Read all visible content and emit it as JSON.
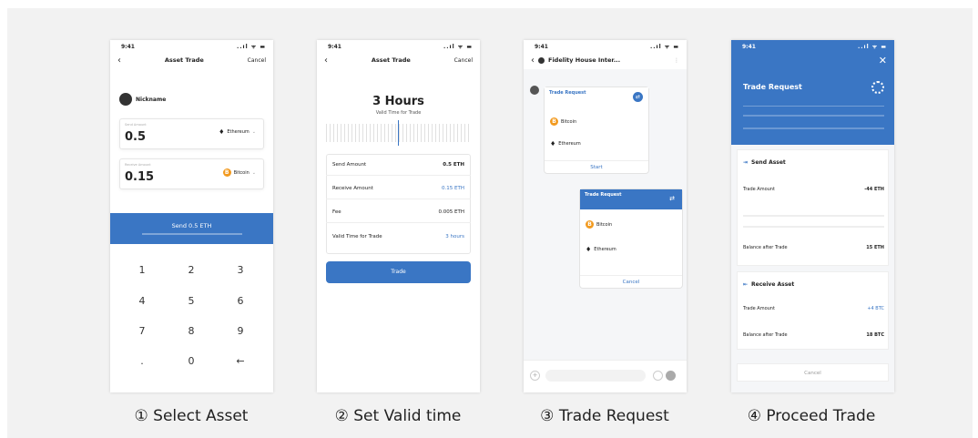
{
  "captions": [
    "① Select Asset",
    "② Set Valid time",
    "③ Trade Request",
    "④ Proceed Trade"
  ],
  "status": {
    "time": "9:41",
    "icons": "..ıl ᯤ ▬"
  },
  "p1": {
    "title": "Asset Trade",
    "cancel": "Cancel",
    "nickname": "Nickname",
    "send_label": "Send Amount",
    "send_value": "0.5",
    "send_coin": "Ethereum",
    "recv_label": "Receive Amount",
    "recv_value": "0.15",
    "recv_coin": "Bitcoin",
    "button": "Send 0.5 ETH",
    "keys": [
      "1",
      "2",
      "3",
      "4",
      "5",
      "6",
      "7",
      "8",
      "9",
      ".",
      "0",
      "←"
    ]
  },
  "p2": {
    "title": "Asset Trade",
    "cancel": "Cancel",
    "hours": "3 Hours",
    "valid_label": "Valid Time for Trade",
    "rows": [
      {
        "label": "Send Amount",
        "value": "0.5 ETH"
      },
      {
        "label": "Receive Amount",
        "value": "0.15 ETH"
      },
      {
        "label": "Fee",
        "value": "0.005 ETH"
      },
      {
        "label": "Valid Time for Trade",
        "value": "3 hours"
      }
    ],
    "button": "Trade"
  },
  "p3": {
    "chat_title": "Fidelity House Inter...",
    "req1_title": "Trade Request",
    "req1_coin1": "Bitcoin",
    "req1_coin2": "Ethereum",
    "req1_action": "Start",
    "req2_title": "Trade Request",
    "req2_coin1": "Bitcoin",
    "req2_coin2": "Ethereum",
    "req2_action": "Cancel"
  },
  "p4": {
    "title": "Trade Request",
    "send_section": "Send Asset",
    "send_trade_label": "Trade Amount",
    "send_trade_value": "-44 ETH",
    "send_balance_label": "Balance after Trade",
    "send_balance_value": "15 ETH",
    "recv_section": "Receive Asset",
    "recv_trade_label": "Trade Amount",
    "recv_trade_value": "+4 BTC",
    "recv_balance_label": "Balance after Trade",
    "recv_balance_value": "18 BTC",
    "cancel": "Cancel"
  }
}
